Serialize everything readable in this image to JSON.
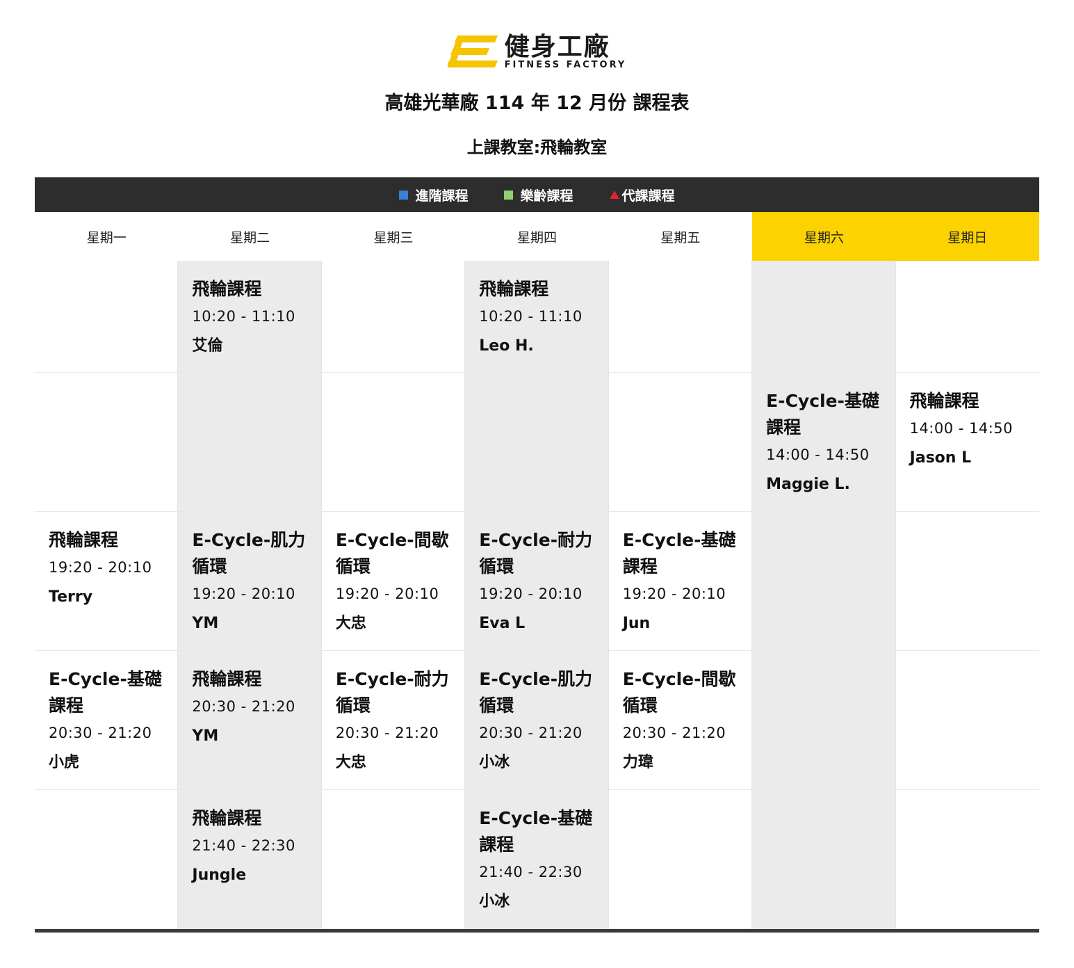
{
  "logo": {
    "cn": "健身工廠",
    "en": "FITNESS FACTORY",
    "accent": "#f6c400"
  },
  "title": "高雄光華廠 114 年 12 月份 課程表",
  "subtitle": "上課教室:飛輪教室",
  "legend": [
    {
      "marker": "blue-square",
      "label": "進階課程",
      "color": "#3a7fd5"
    },
    {
      "marker": "green-square",
      "label": "樂齡課程",
      "color": "#8fd071"
    },
    {
      "marker": "red-triangle",
      "label": "代課課程",
      "color": "#e8202a"
    }
  ],
  "days": [
    "星期一",
    "星期二",
    "星期三",
    "星期四",
    "星期五",
    "星期六",
    "星期日"
  ],
  "rows": [
    [
      null,
      {
        "name": "飛輪課程",
        "time": "10:20 - 11:10",
        "teacher": "艾倫"
      },
      null,
      {
        "name": "飛輪課程",
        "time": "10:20 - 11:10",
        "teacher": "Leo H."
      },
      null,
      null,
      null
    ],
    [
      null,
      null,
      null,
      null,
      null,
      {
        "name": "E-Cycle-基礎課程",
        "time": "14:00 - 14:50",
        "teacher": "Maggie L."
      },
      {
        "name": "飛輪課程",
        "time": "14:00 - 14:50",
        "teacher": "Jason L"
      }
    ],
    [
      {
        "name": "飛輪課程",
        "time": "19:20 - 20:10",
        "teacher": "Terry"
      },
      {
        "name": "E-Cycle-肌力循環",
        "time": "19:20 - 20:10",
        "teacher": "YM"
      },
      {
        "name": "E-Cycle-間歇循環",
        "time": "19:20 - 20:10",
        "teacher": "大忠"
      },
      {
        "name": "E-Cycle-耐力循環",
        "time": "19:20 - 20:10",
        "teacher": "Eva L"
      },
      {
        "name": "E-Cycle-基礎課程",
        "time": "19:20 - 20:10",
        "teacher": "Jun"
      },
      null,
      null
    ],
    [
      {
        "name": "E-Cycle-基礎課程",
        "time": "20:30 - 21:20",
        "teacher": "小虎"
      },
      {
        "name": "飛輪課程",
        "time": "20:30 - 21:20",
        "teacher": "YM"
      },
      {
        "name": "E-Cycle-耐力循環",
        "time": "20:30 - 21:20",
        "teacher": "大忠"
      },
      {
        "name": "E-Cycle-肌力循環",
        "time": "20:30 - 21:20",
        "teacher": "小冰"
      },
      {
        "name": "E-Cycle-間歇循環",
        "time": "20:30 - 21:20",
        "teacher": "力瑋"
      },
      null,
      null
    ],
    [
      null,
      {
        "name": "飛輪課程",
        "time": "21:40 - 22:30",
        "teacher": "Jungle"
      },
      null,
      {
        "name": "E-Cycle-基礎課程",
        "time": "21:40 - 22:30",
        "teacher": "小冰"
      },
      null,
      null,
      null
    ]
  ],
  "colors": {
    "weekend_header": "#fcd200",
    "legend_bar": "#2d2d2d",
    "shaded_column": "#ebebeb"
  }
}
